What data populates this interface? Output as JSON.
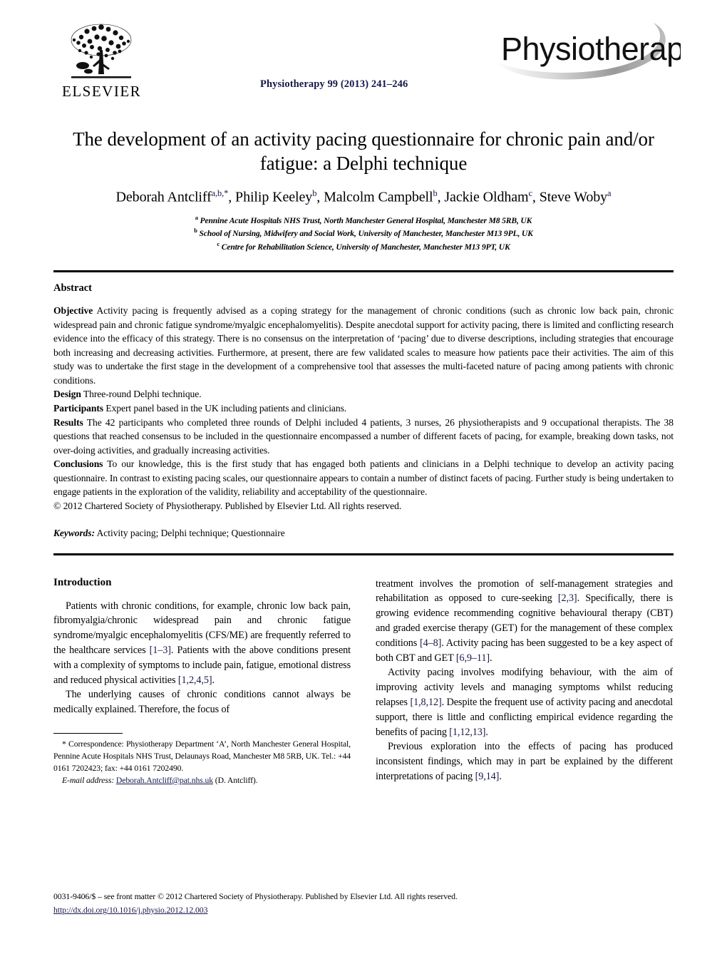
{
  "masthead": {
    "publisher_name": "ELSEVIER",
    "publisher_logo_icon": "elsevier-tree-icon",
    "journal_reference": "Physiotherapy 99 (2013) 241–246",
    "journal_logo_text": "Physiotherapy",
    "journal_logo_icon": "physiotherapy-swoosh-logo"
  },
  "article": {
    "title": "The development of an activity pacing questionnaire for chronic pain and/or fatigue: a Delphi technique",
    "authors_html": "Deborah Antcliff<sup>a,b,*</sup>, Philip Keeley<sup>b</sup>, Malcolm Campbell<sup>b</sup>, Jackie Oldham<sup>c</sup>, Steve Woby<sup>a</sup>",
    "affiliations": [
      {
        "mark": "a",
        "text": "Pennine Acute Hospitals NHS Trust, North Manchester General Hospital, Manchester M8 5RB, UK"
      },
      {
        "mark": "b",
        "text": "School of Nursing, Midwifery and Social Work, University of Manchester, Manchester M13 9PL, UK"
      },
      {
        "mark": "c",
        "text": "Centre for Rehabilitation Science, University of Manchester, Manchester M13 9PT, UK"
      }
    ]
  },
  "abstract": {
    "heading": "Abstract",
    "objective_label": "Objective",
    "objective_text": "Activity pacing is frequently advised as a coping strategy for the management of chronic conditions (such as chronic low back pain, chronic widespread pain and chronic fatigue syndrome/myalgic encephalomyelitis). Despite anecdotal support for activity pacing, there is limited and conflicting research evidence into the efficacy of this strategy. There is no consensus on the interpretation of ‘pacing’ due to diverse descriptions, including strategies that encourage both increasing and decreasing activities. Furthermore, at present, there are few validated scales to measure how patients pace their activities. The aim of this study was to undertake the first stage in the development of a comprehensive tool that assesses the multi-faceted nature of pacing among patients with chronic conditions.",
    "design_label": "Design",
    "design_text": "Three-round Delphi technique.",
    "participants_label": "Participants",
    "participants_text": "Expert panel based in the UK including patients and clinicians.",
    "results_label": "Results",
    "results_text": "The 42 participants who completed three rounds of Delphi included 4 patients, 3 nurses, 26 physiotherapists and 9 occupational therapists. The 38 questions that reached consensus to be included in the questionnaire encompassed a number of different facets of pacing, for example, breaking down tasks, not over-doing activities, and gradually increasing activities.",
    "conclusions_label": "Conclusions",
    "conclusions_text": "To our knowledge, this is the first study that has engaged both patients and clinicians in a Delphi technique to develop an activity pacing questionnaire. In contrast to existing pacing scales, our questionnaire appears to contain a number of distinct facets of pacing. Further study is being undertaken to engage patients in the exploration of the validity, reliability and acceptability of the questionnaire.",
    "copyright_line": "© 2012 Chartered Society of Physiotherapy. Published by Elsevier Ltd. All rights reserved.",
    "keywords_label": "Keywords:",
    "keywords_value": "Activity pacing; Delphi technique; Questionnaire"
  },
  "introduction": {
    "heading": "Introduction",
    "left_paragraphs": [
      "Patients with chronic conditions, for example, chronic low back pain, fibromyalgia/chronic widespread pain and chronic fatigue syndrome/myalgic encephalomyelitis (CFS/ME) are frequently referred to the healthcare services [1–3]. Patients with the above conditions present with a complexity of symptoms to include pain, fatigue, emotional distress and reduced physical activities [1,2,4,5].",
      "The underlying causes of chronic conditions cannot always be medically explained. Therefore, the focus of"
    ],
    "right_paragraphs": [
      "treatment involves the promotion of self-management strategies and rehabilitation as opposed to cure-seeking [2,3]. Specifically, there is growing evidence recommending cognitive behavioural therapy (CBT) and graded exercise therapy (GET) for the management of these complex conditions [4–8]. Activity pacing has been suggested to be a key aspect of both CBT and GET [6,9–11].",
      "Activity pacing involves modifying behaviour, with the aim of improving activity levels and managing symptoms whilst reducing relapses [1,8,12]. Despite the frequent use of activity pacing and anecdotal support, there is little and conflicting empirical evidence regarding the benefits of pacing [1,12,13].",
      "Previous exploration into the effects of pacing has produced inconsistent findings, which may in part be explained by the different interpretations of pacing [9,14]."
    ],
    "citations_left": [
      "[1–3]",
      "[1,2,4,5]"
    ],
    "citations_right": [
      "[2,3]",
      "[4–8]",
      "[6,9–11]",
      "[1,8,12]",
      "[1,12,13]",
      "[9,14]"
    ]
  },
  "footnote": {
    "correspondence_text": "* Correspondence: Physiotherapy Department ‘A’, North Manchester General Hospital, Pennine Acute Hospitals NHS Trust, Delaunays Road, Manchester M8 5RB, UK. Tel.: +44 0161 7202423; fax: +44 0161 7202490.",
    "email_label": "E-mail address:",
    "email_value": "Deborah.Antcliff@pat.nhs.uk",
    "email_suffix": "(D. Antcliff)."
  },
  "footer": {
    "issn_line": "0031-9406/$ – see front matter © 2012 Chartered Society of Physiotherapy. Published by Elsevier Ltd. All rights reserved.",
    "doi_url": "http://dx.doi.org/10.1016/j.physio.2012.12.003"
  },
  "colors": {
    "link_blue": "#17184a",
    "text_black": "#000000",
    "logo_grey": "#8c8c8c"
  }
}
